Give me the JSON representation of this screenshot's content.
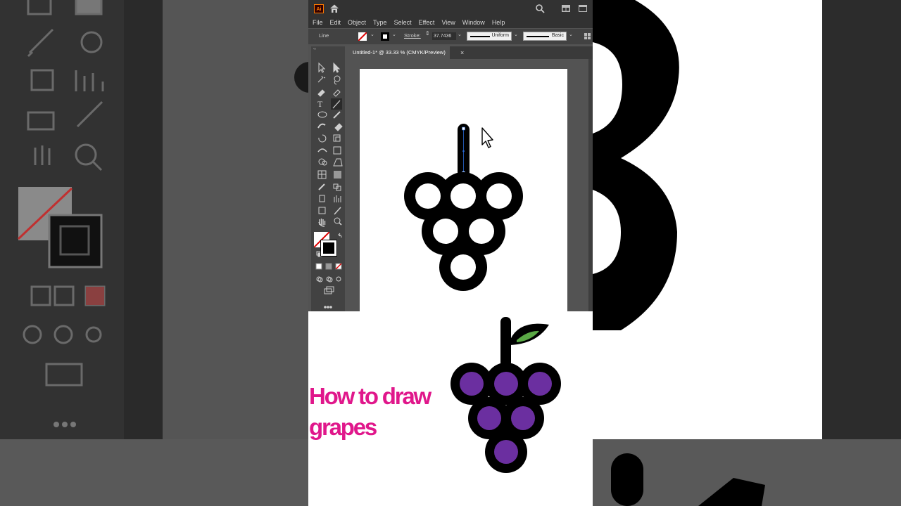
{
  "app": {
    "logo_text": "Ai",
    "menu": [
      "File",
      "Edit",
      "Object",
      "Type",
      "Select",
      "Effect",
      "View",
      "Window",
      "Help"
    ]
  },
  "control_bar": {
    "tool_label": "Line",
    "stroke_label": "Stroke:",
    "stroke_value": "37.7436",
    "profile_1": "Uniform",
    "profile_2": "Basic"
  },
  "document": {
    "tab_title": "Untitled-1* @ 33.33 % (CMYK/Preview)",
    "close_glyph": "×"
  },
  "promo": {
    "title_line_1": "How to draw",
    "title_line_2": "grapes"
  },
  "colors": {
    "title_pink": "#e0178b",
    "grape_purple": "#6b2fa0",
    "leaf_green": "#5aa845",
    "ai_orange": "#ff7c00"
  },
  "icons": [
    "home-icon",
    "search-icon",
    "arrange-icon",
    "panel-icon",
    "cursor-icon",
    "leaf-icon"
  ]
}
